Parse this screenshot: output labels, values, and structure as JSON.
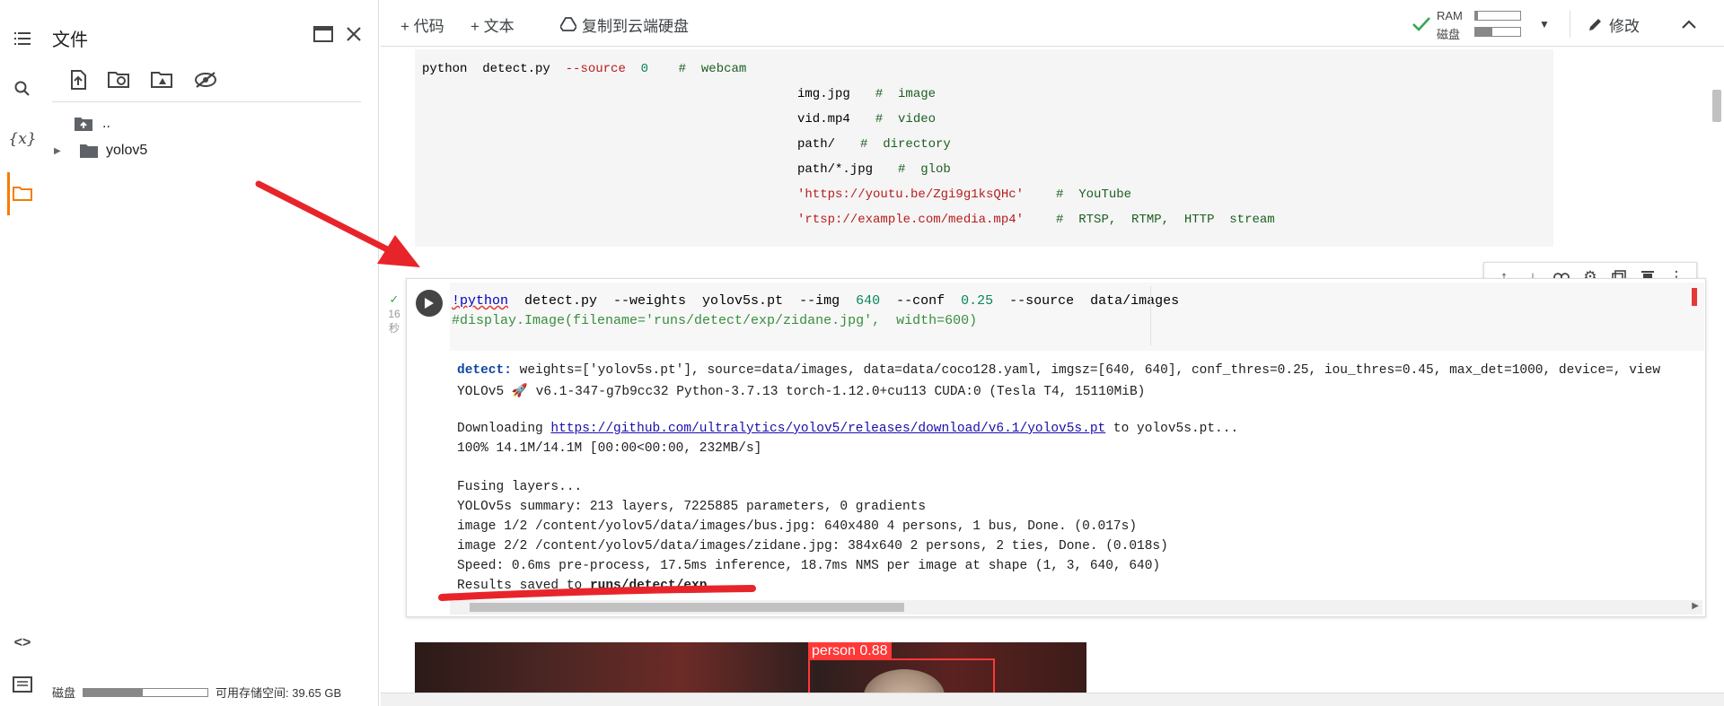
{
  "sidebar_rail": {
    "items": [
      "toc-icon",
      "search-icon",
      "variables-icon",
      "folder-icon"
    ],
    "bottom": [
      "code-snippets-icon",
      "terminal-icon"
    ]
  },
  "files": {
    "title": "文件",
    "tree": [
      {
        "label": "..",
        "icon": "folder-up-icon"
      },
      {
        "label": "yolov5",
        "icon": "folder-icon"
      }
    ],
    "disk_label": "磁盘",
    "disk_available": "可用存储空间: 39.65 GB",
    "disk_used_fraction": 0.48
  },
  "toolbar": {
    "add_code": "+ 代码",
    "add_text": "+ 文本",
    "copy_drive": "复制到云端硬盘",
    "ram_label": "RAM",
    "disk_label": "磁盘",
    "ram_fraction": 0.05,
    "disk_fraction": 0.38,
    "edit": "修改"
  },
  "text_block": {
    "line1_cmd": "python  detect.py  ",
    "line1_flag": "--source",
    "line1_num": "  0",
    "line1_comment": "    #  webcam",
    "rows": [
      {
        "val": "img.jpg",
        "comment": "#  image",
        "is_str": false
      },
      {
        "val": "vid.mp4",
        "comment": "#  video",
        "is_str": false
      },
      {
        "val": "path/",
        "comment": "#  directory",
        "is_str": false
      },
      {
        "val": "path/*.jpg",
        "comment": "#  glob",
        "is_str": false
      },
      {
        "val": "'https://youtu.be/Zgi9g1ksQHc'",
        "comment": "#  YouTube",
        "is_str": true
      },
      {
        "val": "'rtsp://example.com/media.mp4'",
        "comment": "#  RTSP,  RTMP,  HTTP  stream",
        "is_str": true
      }
    ]
  },
  "cell": {
    "status_time": "16",
    "status_unit": "秒",
    "input_line1": {
      "cmd": "!python",
      "rest1": "  detect.py  --weights  yolov5s.pt  --img  ",
      "img": "640",
      "rest2": "  --conf  ",
      "conf": "0.25",
      "rest3": "  --source  data/images"
    },
    "input_line2": "#display.Image(filename='runs/detect/exp/zidane.jpg',  width=600)",
    "output": {
      "detect_label": "detect:",
      "detect_rest": " weights=['yolov5s.pt'], source=data/images, data=data/coco128.yaml, imgsz=[640, 640], conf_thres=0.25, iou_thres=0.45, max_det=1000, device=, view",
      "version": "YOLOv5 🚀 v6.1-347-g7b9cc32 Python-3.7.13 torch-1.12.0+cu113 CUDA:0 (Tesla T4, 15110MiB)",
      "downloading_pre": "Downloading ",
      "downloading_link": "https://github.com/ultralytics/yolov5/releases/download/v6.1/yolov5s.pt",
      "downloading_post": " to yolov5s.pt...",
      "progress": "100% 14.1M/14.1M [00:00<00:00, 232MB/s]",
      "fusing": "Fusing layers...",
      "summary": "YOLOv5s summary: 213 layers, 7225885 parameters, 0 gradients",
      "image1": "image 1/2 /content/yolov5/data/images/bus.jpg: 640x480 4 persons, 1 bus, Done. (0.017s)",
      "image2": "image 2/2 /content/yolov5/data/images/zidane.jpg: 384x640 2 persons, 2 ties, Done. (0.018s)",
      "speed": "Speed: 0.6ms pre-process, 17.5ms inference, 18.7ms NMS per image at shape (1, 3, 640, 640)",
      "results_pre": "Results saved to ",
      "results_path": "runs/detect/exp"
    }
  },
  "preview": {
    "detection_label": "person  0.88"
  },
  "colors": {
    "accent_orange": "#f57c00",
    "annotation_red": "#e8242b",
    "check_green": "#34a853"
  }
}
